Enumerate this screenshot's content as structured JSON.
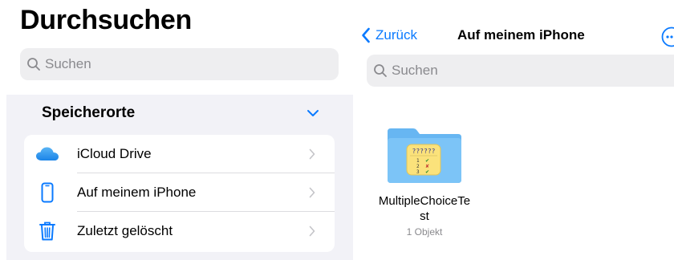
{
  "sidebar": {
    "title": "Durchsuchen",
    "search_placeholder": "Suchen",
    "section_title": "Speicherorte",
    "items": [
      {
        "label": "iCloud Drive",
        "icon": "icloud-icon"
      },
      {
        "label": "Auf meinem iPhone",
        "icon": "iphone-icon"
      },
      {
        "label": "Zuletzt gelöscht",
        "icon": "trash-icon"
      }
    ]
  },
  "pane": {
    "back_label": "Zurück",
    "title": "Auf meinem iPhone",
    "search_placeholder": "Suchen",
    "files": [
      {
        "name": "MultipleChoiceTest",
        "meta": "1 Objekt",
        "icon": "folder-icon"
      }
    ]
  },
  "colors": {
    "accent": "#0a7aff",
    "folder": "#7cc4f7",
    "sidebar_section_bg": "#f2f2f7",
    "search_bg": "#eeeef0"
  }
}
